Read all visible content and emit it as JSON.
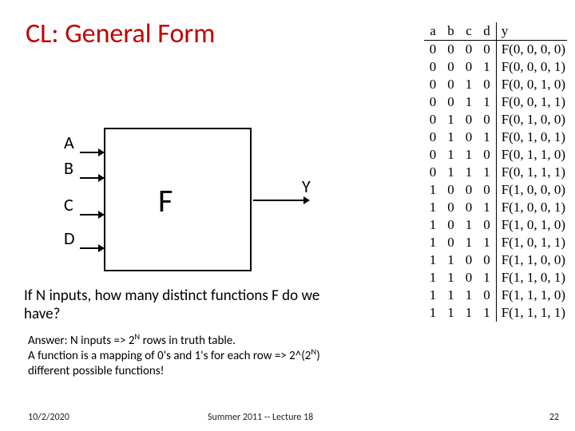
{
  "title": "CL: General Form",
  "inputs": [
    "A",
    "B",
    "C",
    "D"
  ],
  "block_label": "F",
  "output_label": "Y",
  "question": "If N inputs, how many distinct functions F do we have?",
  "answer_line1": "Answer:  N inputs => 2",
  "answer_sup1": "N",
  "answer_line1b": " rows in truth table.",
  "answer_line2": "A function is a mapping of 0's and 1's for each row => 2^(2",
  "answer_sup2": "N",
  "answer_line2b": ") different possible functions!",
  "footer": {
    "date": "10/2/2020",
    "center": "Summer 2011 -- Lecture 18",
    "page": "22"
  },
  "truth_table": {
    "headers": [
      "a",
      "b",
      "c",
      "d",
      "y"
    ],
    "rows": [
      [
        "0",
        "0",
        "0",
        "0",
        "F(0, 0, 0, 0)"
      ],
      [
        "0",
        "0",
        "0",
        "1",
        "F(0, 0, 0, 1)"
      ],
      [
        "0",
        "0",
        "1",
        "0",
        "F(0, 0, 1, 0)"
      ],
      [
        "0",
        "0",
        "1",
        "1",
        "F(0, 0, 1, 1)"
      ],
      [
        "0",
        "1",
        "0",
        "0",
        "F(0, 1, 0, 0)"
      ],
      [
        "0",
        "1",
        "0",
        "1",
        "F(0, 1, 0, 1)"
      ],
      [
        "0",
        "1",
        "1",
        "0",
        "F(0, 1, 1, 0)"
      ],
      [
        "0",
        "1",
        "1",
        "1",
        "F(0, 1, 1, 1)"
      ],
      [
        "1",
        "0",
        "0",
        "0",
        "F(1, 0, 0, 0)"
      ],
      [
        "1",
        "0",
        "0",
        "1",
        "F(1, 0, 0, 1)"
      ],
      [
        "1",
        "0",
        "1",
        "0",
        "F(1, 0, 1, 0)"
      ],
      [
        "1",
        "0",
        "1",
        "1",
        "F(1, 0, 1, 1)"
      ],
      [
        "1",
        "1",
        "0",
        "0",
        "F(1, 1, 0, 0)"
      ],
      [
        "1",
        "1",
        "0",
        "1",
        "F(1, 1, 0, 1)"
      ],
      [
        "1",
        "1",
        "1",
        "0",
        "F(1, 1, 1, 0)"
      ],
      [
        "1",
        "1",
        "1",
        "1",
        "F(1, 1, 1, 1)"
      ]
    ]
  }
}
